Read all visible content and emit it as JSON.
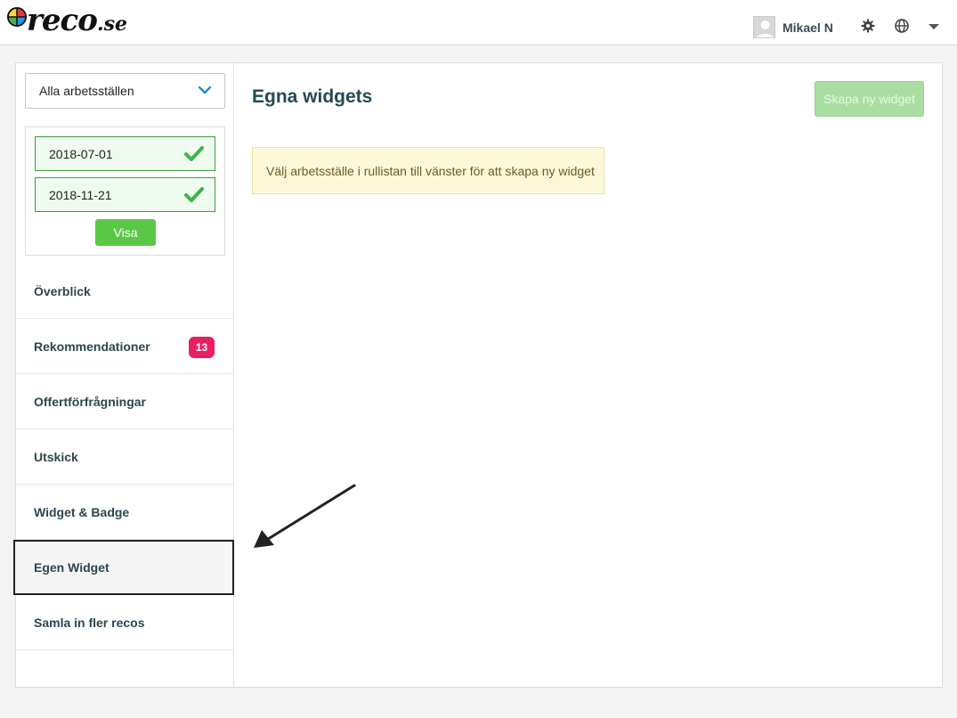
{
  "header": {
    "logo_main": "reco",
    "logo_suffix": ".se",
    "user_name": "Mikael N",
    "icons": {
      "settings": "gear-icon",
      "language": "globe-icon",
      "menu": "caret-down-icon"
    }
  },
  "sidebar": {
    "workplace_select": "Alla arbetsställen",
    "date_from": "2018-07-01",
    "date_to": "2018-11-21",
    "show_button": "Visa",
    "items": [
      {
        "label": "Överblick"
      },
      {
        "label": "Rekommendationer",
        "badge": "13"
      },
      {
        "label": "Offertförfrågningar"
      },
      {
        "label": "Utskick"
      },
      {
        "label": "Widget & Badge"
      },
      {
        "label": "Egen Widget",
        "active": true
      },
      {
        "label": "Samla in fler recos"
      }
    ]
  },
  "main": {
    "title": "Egna widgets",
    "create_button": "Skapa ny widget",
    "notice": "Välj arbetsställe i rullistan till vänster för att skapa ny widget"
  },
  "colors": {
    "accent_green": "#5bc845",
    "badge_pink": "#e91e63",
    "title_teal": "#244a55",
    "notice_bg": "#fcf8d8"
  }
}
